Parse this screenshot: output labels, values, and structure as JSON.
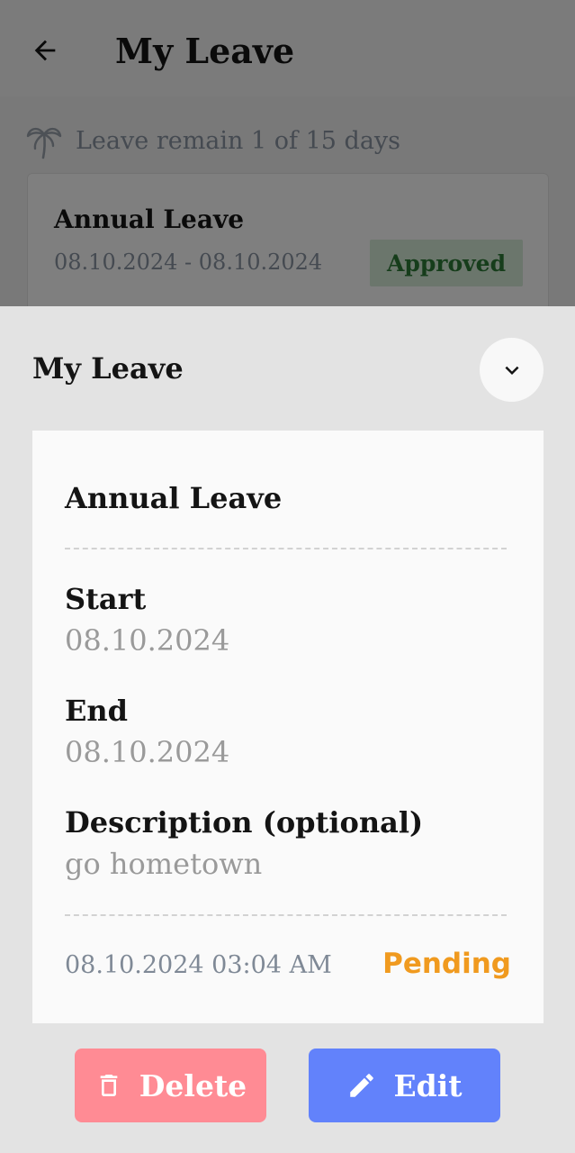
{
  "app_bar": {
    "title": "My Leave",
    "back_icon": "arrow-back-icon"
  },
  "summary": {
    "icon": "palm-tree-icon",
    "text": "Leave remain 1 of 15 days"
  },
  "background_card": {
    "title": "Annual Leave",
    "dates": "08.10.2024 - 08.10.2024",
    "status": "Approved",
    "status_color": "#2c7a36"
  },
  "sheet": {
    "title": "My Leave",
    "collapse_icon": "chevron-down-icon",
    "detail": {
      "type": "Annual Leave",
      "start_label": "Start",
      "start_value": "08.10.2024",
      "end_label": "End",
      "end_value": "08.10.2024",
      "description_label": "Description (optional)",
      "description_value": "go hometown",
      "created_at": "08.10.2024 03:04 AM",
      "status": "Pending",
      "status_color": "#f09a1f"
    },
    "actions": {
      "delete_label": "Delete",
      "delete_icon": "trash-icon",
      "delete_color": "#ff8b94",
      "edit_label": "Edit",
      "edit_icon": "pencil-icon",
      "edit_color": "#6282fb"
    }
  }
}
